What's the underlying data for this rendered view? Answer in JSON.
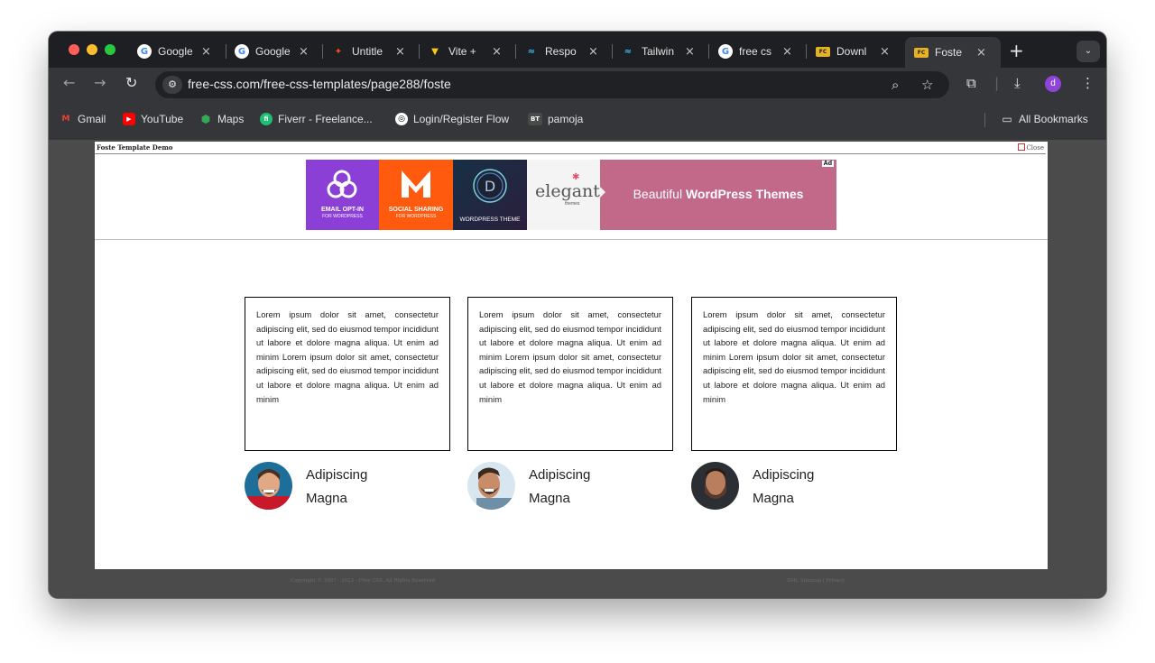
{
  "browser": {
    "tabs": [
      {
        "title": "Google",
        "icon": "google-icon",
        "fav": "G",
        "color": "#4285f4"
      },
      {
        "title": "Google",
        "icon": "google-icon",
        "fav": "G",
        "color": "#4285f4"
      },
      {
        "title": "Untitle",
        "icon": "figma-icon",
        "fav": "F",
        "color": "#f24e1e"
      },
      {
        "title": "Vite + ",
        "icon": "vite-icon",
        "fav": "V",
        "color": "#a855f7"
      },
      {
        "title": "Respo",
        "icon": "tailwind-icon",
        "fav": "~",
        "color": "#38bdf8"
      },
      {
        "title": "Tailwin",
        "icon": "tailwind-icon",
        "fav": "~",
        "color": "#38bdf8"
      },
      {
        "title": "free cs",
        "icon": "google-icon",
        "fav": "G",
        "color": "#4285f4"
      },
      {
        "title": "Downl",
        "icon": "freecss-icon",
        "fav": "▭",
        "color": "#e6b325"
      },
      {
        "title": "Foste",
        "icon": "freecss-icon",
        "fav": "▭",
        "color": "#e6b325"
      }
    ],
    "tab_close": "×",
    "new_tab": "+",
    "url": "free-css.com/free-css-templates/page288/foste",
    "profile_initial": "d",
    "bookmarks": [
      {
        "label": "Gmail",
        "icon": "gmail-icon",
        "glyph": "M",
        "color": "#ea4335"
      },
      {
        "label": "YouTube",
        "icon": "youtube-icon",
        "glyph": "▶",
        "color": "#ff0000"
      },
      {
        "label": "Maps",
        "icon": "maps-icon",
        "glyph": "⬤",
        "color": "#34a853"
      },
      {
        "label": "Fiverr - Freelance...",
        "icon": "fiverr-icon",
        "glyph": "fi",
        "color": "#1dbf73"
      },
      {
        "label": "Login/Register Flow",
        "icon": "chatgpt-icon",
        "glyph": "◎",
        "color": "#3c3d40"
      },
      {
        "label": "pamoja",
        "icon": "bt-icon",
        "glyph": "BT",
        "color": "#4a4a4a"
      }
    ],
    "all_bookmarks": "All Bookmarks"
  },
  "demo_bar": {
    "title": "Foste Template Demo",
    "close": "Close"
  },
  "ad": {
    "tag": "Ad",
    "panels": [
      {
        "line1": "EMAIL OPT-IN",
        "line2": "FOR WORDPRESS",
        "color": "#8b3fd6"
      },
      {
        "line1": "SOCIAL SHARING",
        "line2": "FOR WORDPRESS",
        "color": "#ff5a0d"
      },
      {
        "line1": "WORDPRESS THEME",
        "line2": "",
        "color": "#2a2d3c"
      },
      {
        "line1": "elegant",
        "line2": "themes",
        "color": "#f3f3f3"
      }
    ],
    "tagline_plain": "Beautiful ",
    "tagline_bold": "WordPress Themes",
    "tagline_bg": "#c2698a"
  },
  "testimonials": [
    {
      "text": "Lorem ipsum dolor sit amet, consectetur adipiscing elit, sed do eiusmod tempor incididunt ut labore et dolore magna aliqua. Ut enim ad minim Lorem ipsum dolor sit amet, consectetur adipiscing elit, sed do eiusmod tempor incididunt ut labore et dolore magna aliqua. Ut enim ad minim",
      "name_line1": "Adipiscing",
      "name_line2": "Magna"
    },
    {
      "text": "Lorem ipsum dolor sit amet, consectetur adipiscing elit, sed do eiusmod tempor incididunt ut labore et dolore magna aliqua. Ut enim ad minim Lorem ipsum dolor sit amet, consectetur adipiscing elit, sed do eiusmod tempor incididunt ut labore et dolore magna aliqua. Ut enim ad minim",
      "name_line1": "Adipiscing",
      "name_line2": "Magna"
    },
    {
      "text": "Lorem ipsum dolor sit amet, consectetur adipiscing elit, sed do eiusmod tempor incididunt ut labore et dolore magna aliqua. Ut enim ad minim Lorem ipsum dolor sit amet, consectetur adipiscing elit, sed do eiusmod tempor incididunt ut labore et dolore magna aliqua. Ut enim ad minim",
      "name_line1": "Adipiscing",
      "name_line2": "Magna"
    }
  ],
  "footer": {
    "copyright": "Copyright © 2007 - 2023 - Free CSS. All Rights Reserved",
    "links": "XML Sitemap | Privacy"
  }
}
